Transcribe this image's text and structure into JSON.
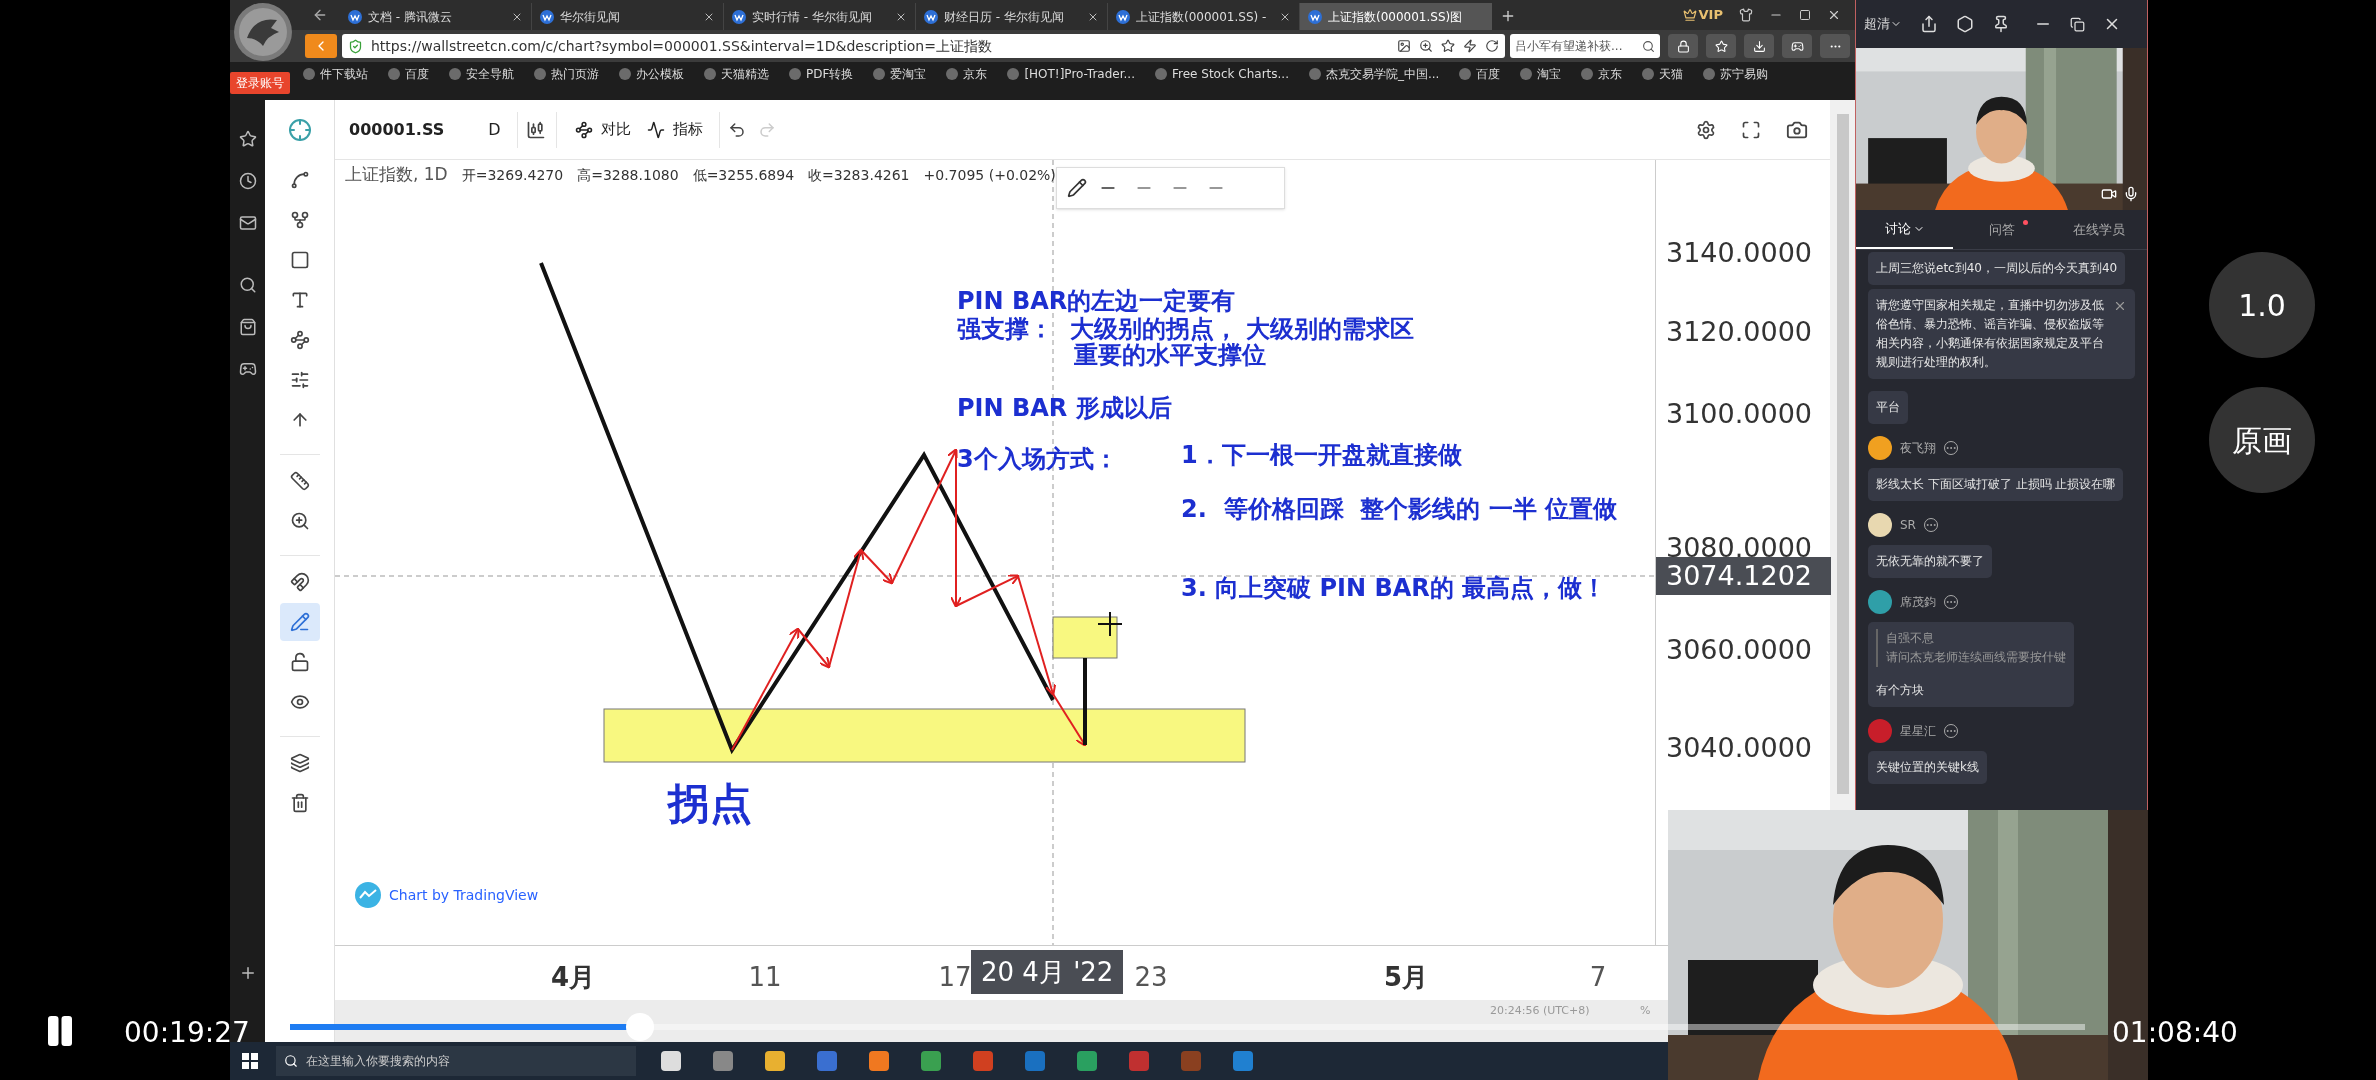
{
  "player": {
    "current_time": "00:19:27",
    "end_time": "01:08:40",
    "progress": {
      "level": 0.195
    },
    "speed": "1.0",
    "quality": "原画"
  },
  "browser": {
    "login_badge": "登录账号",
    "tabs": [
      {
        "label": "文档 - 腾讯微云",
        "selected": false
      },
      {
        "label": "华尔街见闻",
        "selected": false
      },
      {
        "label": "实时行情 - 华尔街见闻",
        "selected": false
      },
      {
        "label": "财经日历 - 华尔街见闻",
        "selected": false
      },
      {
        "label": "上证指数(000001.SS) -",
        "selected": false
      },
      {
        "label": "上证指数(000001.SS)图",
        "selected": true
      }
    ],
    "vip": "VIP",
    "address": "https://wallstreetcn.com/c/chart?symbol=000001.SS&interval=1D&description=上证指数",
    "search_value": "吕小军有望递补获...",
    "bookmarks": [
      "件下载站",
      "百度",
      "安全导航",
      "热门页游",
      "办公模板",
      "天猫精选",
      "PDF转换",
      "爱淘宝",
      "京东",
      "[HOT!]Pro-Trader...",
      "Free Stock Charts...",
      "杰克交易学院_中国...",
      "百度",
      "淘宝",
      "京东",
      "天猫",
      "苏宁易购"
    ]
  },
  "chart": {
    "symbol": "000001.SS",
    "interval": "D",
    "toolbar_buttons": [
      "对比",
      "指标"
    ],
    "legend_title": "上证指数, 1D",
    "legend_values": [
      "开=3269.4270",
      "高=3288.1080",
      "低=3255.6894",
      "收=3283.4261"
    ],
    "change": "+0.7095 (+0.02%)",
    "annotations": [
      "PIN BAR的左边一定要有",
      "强支撑：  大级别的拐点， 大级别的需求区",
      "重要的水平支撑位",
      "PIN BAR 形成以后",
      "3个入场方式：",
      "1．下一根一开盘就直接做",
      "2.  等价格回踩  整个影线的 一半 位置做",
      "3. 向上突破 PIN BAR的 最高点，做！"
    ],
    "pivot_label": "拐点",
    "credit": "Chart by TradingView",
    "price_labels": [
      "3140.0000",
      "3120.0000",
      "3100.0000",
      "3080.0000",
      "3060.0000",
      "3040.0000"
    ],
    "crosshair_price": "3074.1202",
    "time_labels": [
      {
        "text": "4月",
        "kind": "month"
      },
      {
        "text": "11",
        "kind": "day"
      },
      {
        "text": "17",
        "kind": "day"
      },
      {
        "text": "23",
        "kind": "day"
      },
      {
        "text": "5月",
        "kind": "month"
      },
      {
        "text": "7",
        "kind": "day"
      }
    ],
    "crosshair_time": "20 4月 '22",
    "tool_groups": [
      [
        {
          "kind": "line",
          "selected": false
        },
        {
          "kind": "fork",
          "selected": false
        },
        {
          "kind": "rect",
          "selected": false
        },
        {
          "kind": "text",
          "selected": false
        },
        {
          "kind": "pattern",
          "selected": false
        },
        {
          "kind": "fib",
          "selected": false
        },
        {
          "kind": "arrow",
          "selected": false
        }
      ],
      [
        {
          "kind": "ruler",
          "selected": false
        },
        {
          "kind": "zoom",
          "selected": false
        }
      ],
      [
        {
          "kind": "magnet",
          "selected": false
        },
        {
          "kind": "lock_draw",
          "selected": true
        },
        {
          "kind": "lock",
          "selected": false
        },
        {
          "kind": "eye",
          "selected": false
        }
      ],
      [
        {
          "kind": "layers",
          "selected": false
        },
        {
          "kind": "trash",
          "selected": false
        }
      ]
    ],
    "status_time": "20:24:56 (UTC+8)",
    "status_percent": "%"
  },
  "taskbar": {
    "search_placeholder": "在这里输入你要搜索的内容"
  },
  "live": {
    "quality": "超清",
    "tabs": [
      {
        "label": "讨论",
        "selected": true,
        "unread": false
      },
      {
        "label": "问答",
        "selected": false,
        "unread": true
      },
      {
        "label": "在线学员",
        "selected": false,
        "unread": false
      }
    ],
    "messages": [
      {
        "kind": "plain",
        "text": "上周三您说etc到40，一周以后的今天真到40"
      },
      {
        "kind": "notice",
        "text": "请您遵守国家相关规定，直播中切勿涉及低俗色情、暴力恐怖、谣言诈骗、侵权盗版等相关内容，小鹅通保有依据国家规定及平台规则进行处理的权利。"
      },
      {
        "kind": "plain",
        "text": "平台"
      },
      {
        "kind": "user",
        "user": "夜飞翔",
        "color": "#f0a020",
        "text": "影线太长 下面区域打破了 止损吗 止损设在哪"
      },
      {
        "kind": "user",
        "user": "SR",
        "color": "#e8d8b0",
        "text": "无依无靠的就不要了"
      },
      {
        "kind": "user",
        "user": "席茂鈞",
        "color": "#2f9fa8",
        "quote_author": "自强不息",
        "quote_text": "请问杰克老师连续画线需要按什键",
        "text": "有个方块"
      },
      {
        "kind": "user",
        "user": "星星汇",
        "color": "#c81e2a",
        "text": "关键位置的关键k线"
      }
    ]
  }
}
